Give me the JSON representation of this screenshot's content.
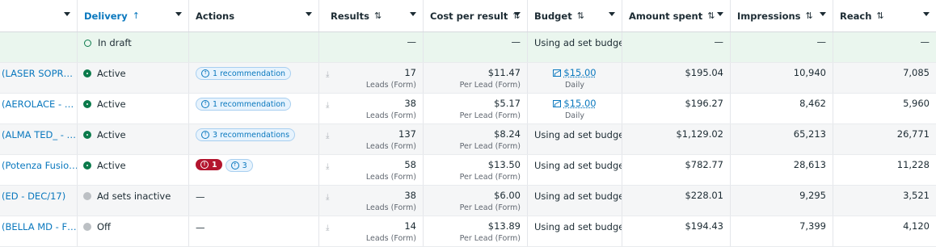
{
  "headers": {
    "delivery": "Delivery",
    "delivery_sort": "↑",
    "actions": "Actions",
    "results": "Results",
    "cost_per_result": "Cost per result",
    "budget": "Budget",
    "amount_spent": "Amount spent",
    "impressions": "Impressions",
    "reach": "Reach",
    "sort_icon": "⇅"
  },
  "draft_row": {
    "delivery": "In draft",
    "results": "—",
    "cost": "—",
    "budget": "Using ad set budget",
    "spent": "—",
    "impressions": "—",
    "reach": "—"
  },
  "rows": [
    {
      "name": "(LASER SOPR…",
      "delivery": "Active",
      "status": "active",
      "actions": "1 recommendation",
      "results": "17",
      "results_sub": "Leads (Form)",
      "cost": "$11.47",
      "cost_sub": "Per Lead (Form)",
      "budget": "$15.00",
      "budget_sub": "Daily",
      "budget_link": true,
      "spent": "$195.04",
      "impressions": "10,940",
      "reach": "7,085"
    },
    {
      "name": "(AEROLACE - …",
      "delivery": "Active",
      "status": "active",
      "actions": "1 recommendation",
      "results": "38",
      "results_sub": "Leads (Form)",
      "cost": "$5.17",
      "cost_sub": "Per Lead (Form)",
      "budget": "$15.00",
      "budget_sub": "Daily",
      "budget_link": true,
      "spent": "$196.27",
      "impressions": "8,462",
      "reach": "5,960"
    },
    {
      "name": "(ALMA TED_ - …",
      "delivery": "Active",
      "status": "active",
      "actions": "3 recommendations",
      "results": "137",
      "results_sub": "Leads (Form)",
      "cost": "$8.24",
      "cost_sub": "Per Lead (Form)",
      "budget": "Using ad set budget",
      "spent": "$1,129.02",
      "impressions": "65,213",
      "reach": "26,771"
    },
    {
      "name": "(Potenza Fusio…",
      "delivery": "Active",
      "status": "active",
      "actions_red": "1",
      "actions": "3",
      "results": "58",
      "results_sub": "Leads (Form)",
      "cost": "$13.50",
      "cost_sub": "Per Lead (Form)",
      "budget": "Using ad set budget",
      "spent": "$782.77",
      "impressions": "28,613",
      "reach": "11,228"
    },
    {
      "name": "(ED - DEC/17)",
      "delivery": "Ad sets inactive",
      "status": "off",
      "actions_dash": "—",
      "results": "38",
      "results_sub": "Leads (Form)",
      "cost": "$6.00",
      "cost_sub": "Per Lead (Form)",
      "budget": "Using ad set budget",
      "spent": "$228.01",
      "impressions": "9,295",
      "reach": "3,521"
    },
    {
      "name": "(BELLA MD - F…",
      "delivery": "Off",
      "status": "off",
      "actions_dash": "—",
      "results": "14",
      "results_sub": "Leads (Form)",
      "cost": "$13.89",
      "cost_sub": "Per Lead (Form)",
      "budget": "Using ad set budget",
      "spent": "$194.43",
      "impressions": "7,399",
      "reach": "4,120"
    }
  ]
}
